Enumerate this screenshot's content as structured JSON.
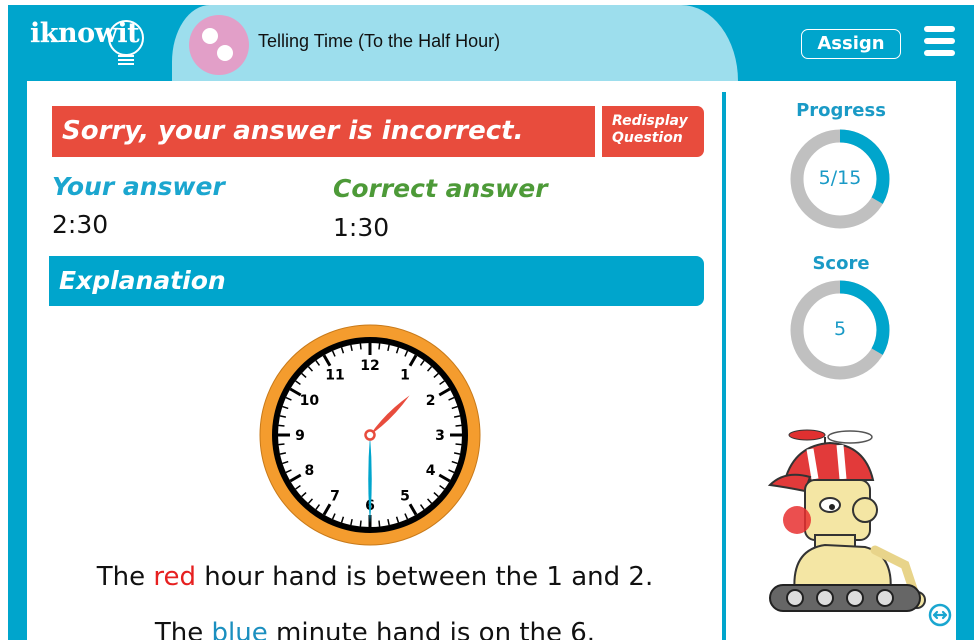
{
  "header": {
    "logo_text": "iknowit",
    "lesson_title": "Telling Time (To the Half Hour)",
    "assign_label": "Assign",
    "menu_icon": "hamburger-menu-icon"
  },
  "feedback": {
    "banner_text": "Sorry, your answer is incorrect.",
    "redisplay_line1": "Redisplay",
    "redisplay_line2": "Question",
    "your_answer_label": "Your answer",
    "your_answer_value": "2:30",
    "correct_answer_label": "Correct answer",
    "correct_answer_value": "1:30"
  },
  "explanation": {
    "title": "Explanation",
    "clock": {
      "hour": 1,
      "minute": 30,
      "numbers": [
        "12",
        "1",
        "2",
        "3",
        "4",
        "5",
        "6",
        "7",
        "8",
        "9",
        "10",
        "11"
      ],
      "hour_hand_color": "#e84c3d",
      "minute_hand_color": "#00a5cc",
      "rim_color": "#f49c2e"
    },
    "sentence1": {
      "pre": "The ",
      "colored": "red",
      "post": " hour hand is between the 1 and 2."
    },
    "sentence2": {
      "pre": "The ",
      "colored": "blue",
      "post": " minute hand is on the 6."
    }
  },
  "sidebar": {
    "progress_label": "Progress",
    "progress_text": "5/15",
    "progress_fraction": 0.3333,
    "score_label": "Score",
    "score_text": "5",
    "score_fraction": 0.3333
  },
  "colors": {
    "brand": "#00a5cc",
    "error": "#e84c3d",
    "correct": "#4d9a38",
    "ring_track": "#c0c0c0"
  }
}
